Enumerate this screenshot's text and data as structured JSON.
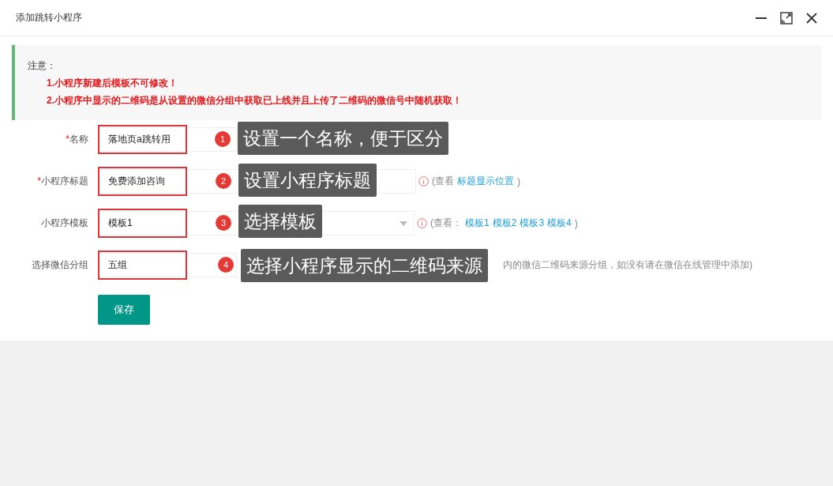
{
  "window": {
    "title": "添加跳转小程序",
    "controls": [
      {
        "kind": "minimize"
      },
      {
        "kind": "maximize"
      },
      {
        "kind": "close"
      }
    ]
  },
  "notice": {
    "heading": "注意：",
    "items": [
      "1.小程序新建后模板不可修改！",
      "2.小程序中显示的二维码是从设置的微信分组中获取已上线并且上传了二维码的微信号中随机获取！"
    ]
  },
  "form": {
    "rows": [
      {
        "label": "名称",
        "mark": "*",
        "kind": "input",
        "value": "落地页a跳转用",
        "callout": {
          "number": "1",
          "text": "设置一个名称，便于区分"
        }
      },
      {
        "label": "小程序标题",
        "mark": "*",
        "kind": "input",
        "value": "免费添加咨询",
        "hint": {
          "kind": "info",
          "prefix": "(查看",
          "links": [
            "标题显示位置"
          ],
          "suffix": ")"
        },
        "callout": {
          "number": "2",
          "text": "设置小程序标题"
        }
      },
      {
        "label": "小程序模板",
        "kind": "select",
        "value": "模板1",
        "hint": {
          "kind": "info",
          "prefix": "(查看：",
          "links": [
            "模板1",
            "模板2",
            "模板3",
            "模板4"
          ],
          "suffix": ")"
        },
        "callout": {
          "number": "3",
          "text": "选择模板"
        }
      },
      {
        "label": "选择微信分组",
        "kind": "input",
        "value": "五组",
        "hint": {
          "kind": "covered",
          "prefix": "内的微信二维码来源分组，如没有请在微信在线管理中添加)"
        },
        "callout": {
          "number": "4",
          "text": "选择小程序显示的二维码来源"
        }
      }
    ],
    "save_button": "保存"
  }
}
